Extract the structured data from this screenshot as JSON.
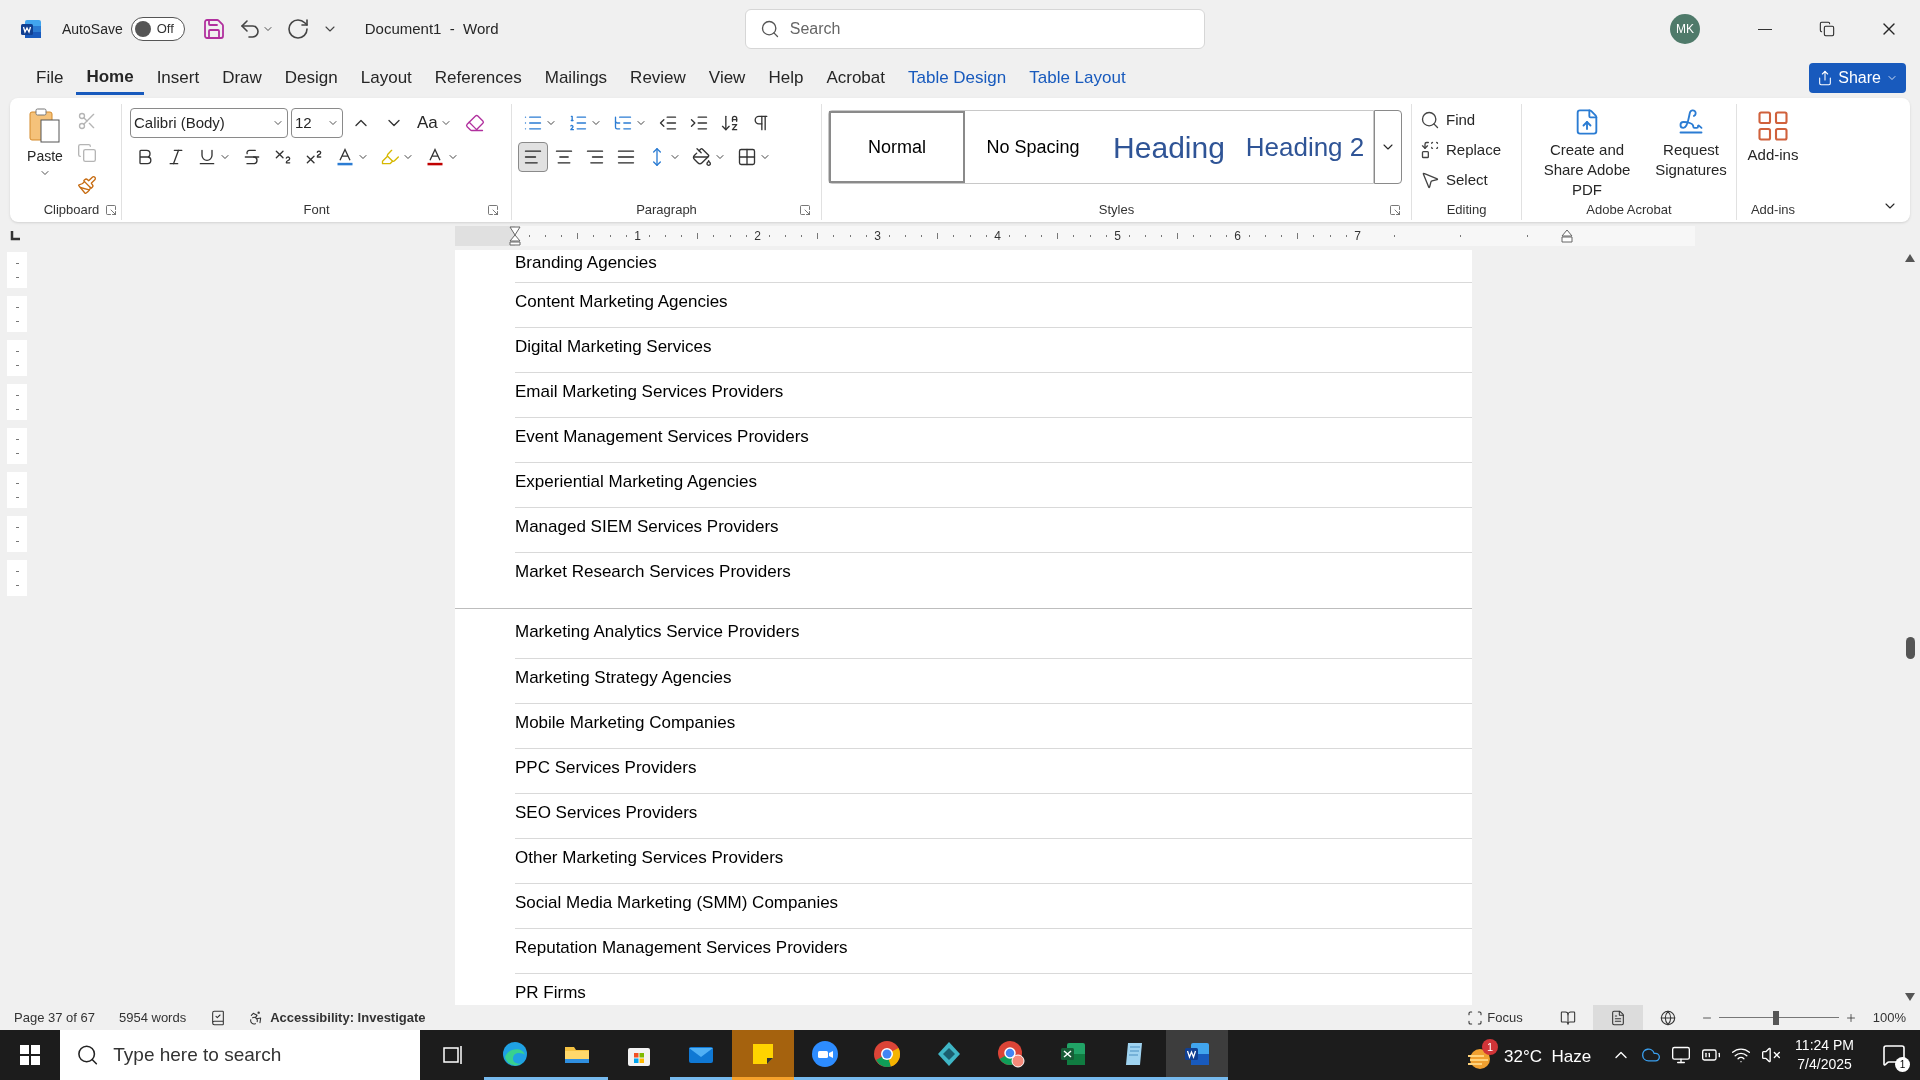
{
  "title_bar": {
    "autosave_label": "AutoSave",
    "autosave": {
      "on": false,
      "label": "Off"
    },
    "document_title": "Document1  -  Word",
    "search_placeholder": "Search",
    "avatar": "MK"
  },
  "ribbon_tabs": [
    {
      "label": "File",
      "selected": false,
      "kind": "normal"
    },
    {
      "label": "Home",
      "selected": true,
      "kind": "normal"
    },
    {
      "label": "Insert",
      "selected": false,
      "kind": "normal"
    },
    {
      "label": "Draw",
      "selected": false,
      "kind": "normal"
    },
    {
      "label": "Design",
      "selected": false,
      "kind": "normal"
    },
    {
      "label": "Layout",
      "selected": false,
      "kind": "normal"
    },
    {
      "label": "References",
      "selected": false,
      "kind": "normal"
    },
    {
      "label": "Mailings",
      "selected": false,
      "kind": "normal"
    },
    {
      "label": "Review",
      "selected": false,
      "kind": "normal"
    },
    {
      "label": "View",
      "selected": false,
      "kind": "normal"
    },
    {
      "label": "Help",
      "selected": false,
      "kind": "normal"
    },
    {
      "label": "Acrobat",
      "selected": false,
      "kind": "normal"
    },
    {
      "label": "Table Design",
      "selected": false,
      "kind": "contextual"
    },
    {
      "label": "Table Layout",
      "selected": false,
      "kind": "contextual"
    }
  ],
  "share_button": "Share",
  "ribbon": {
    "clipboard": {
      "label": "Clipboard",
      "paste": "Paste",
      "tools": [
        {
          "kind": "cut",
          "disabled": true
        },
        {
          "kind": "copy",
          "disabled": true
        },
        {
          "kind": "format-painter",
          "disabled": false
        }
      ]
    },
    "font": {
      "label": "Font",
      "font_name": "Calibri (Body)",
      "font_size": "12",
      "change_case": "Aa"
    },
    "paragraph": {
      "label": "Paragraph",
      "alignment": [
        {
          "kind": "left",
          "selected": true
        },
        {
          "kind": "center",
          "selected": false
        },
        {
          "kind": "right",
          "selected": false
        },
        {
          "kind": "justify",
          "selected": false
        }
      ]
    },
    "styles": {
      "label": "Styles",
      "items": [
        {
          "label": "Normal",
          "selected": true,
          "kind": "normal"
        },
        {
          "label": "No Spacing",
          "selected": false,
          "kind": "normal"
        },
        {
          "label": "Heading",
          "selected": false,
          "kind": "heading1"
        },
        {
          "label": "Heading 2",
          "selected": false,
          "kind": "heading2"
        }
      ]
    },
    "editing": {
      "label": "Editing",
      "items": [
        {
          "label": "Find",
          "kind": "find"
        },
        {
          "label": "Replace",
          "kind": "replace"
        },
        {
          "label": "Select",
          "kind": "select"
        }
      ]
    },
    "acrobat": {
      "label": "Adobe Acrobat",
      "items": [
        {
          "label": "Create and Share Adobe PDF",
          "kind": "pdf"
        },
        {
          "label": "Request Signatures",
          "kind": "sign"
        }
      ]
    },
    "addins": {
      "label": "Add-ins",
      "button": "Add-ins"
    }
  },
  "ruler": {
    "labels": [
      "1",
      "2",
      "3",
      "4",
      "5",
      "6",
      "7"
    ]
  },
  "document": {
    "pages": [
      {
        "rows": [
          "Branding Agencies",
          "Content Marketing Agencies",
          "Digital Marketing Services",
          "Email Marketing Services Providers",
          "Event Management Services Providers",
          "Experiential Marketing Agencies",
          "Managed SIEM Services Providers",
          "Market Research Services Providers"
        ]
      },
      {
        "rows": [
          "Marketing Analytics Service Providers",
          "Marketing Strategy Agencies",
          "Mobile Marketing Companies",
          "PPC Services Providers",
          "SEO Services Providers",
          "Other Marketing Services Providers",
          "Social Media Marketing (SMM) Companies",
          "Reputation Management Services Providers",
          "PR Firms"
        ]
      }
    ]
  },
  "status_bar": {
    "page": "Page 37 of 67",
    "words": "5954 words",
    "accessibility": "Accessibility: Investigate",
    "focus": "Focus",
    "views": [
      {
        "kind": "read",
        "selected": false
      },
      {
        "kind": "print",
        "selected": true
      },
      {
        "kind": "web",
        "selected": false
      }
    ],
    "zoom": {
      "level": 0.48,
      "label": "100%"
    }
  },
  "taskbar": {
    "search_placeholder": "Type here to search",
    "apps": [
      {
        "kind": "task-view",
        "selected": false,
        "running": false,
        "attention": false
      },
      {
        "kind": "browser-wave",
        "selected": false,
        "running": true,
        "attention": false
      },
      {
        "kind": "folder",
        "selected": false,
        "running": true,
        "attention": false
      },
      {
        "kind": "store",
        "selected": false,
        "running": false,
        "attention": false
      },
      {
        "kind": "mail",
        "selected": false,
        "running": true,
        "attention": false
      },
      {
        "kind": "sticky-note",
        "selected": false,
        "running": true,
        "attention": true
      },
      {
        "kind": "video",
        "selected": false,
        "running": true,
        "attention": false
      },
      {
        "kind": "browser-ring",
        "selected": false,
        "running": true,
        "attention": false
      },
      {
        "kind": "diamond",
        "selected": false,
        "running": true,
        "attention": false
      },
      {
        "kind": "browser-ring-profile",
        "selected": false,
        "running": true,
        "attention": false
      },
      {
        "kind": "spreadsheet",
        "selected": false,
        "running": true,
        "attention": false
      },
      {
        "kind": "notepad",
        "selected": false,
        "running": true,
        "attention": false
      },
      {
        "kind": "document",
        "selected": true,
        "running": true,
        "attention": false
      }
    ],
    "weather": {
      "badge": "1",
      "text": "32°C  Haze"
    },
    "time": "11:24 PM",
    "date": "7/4/2025",
    "notification_count": "1"
  }
}
